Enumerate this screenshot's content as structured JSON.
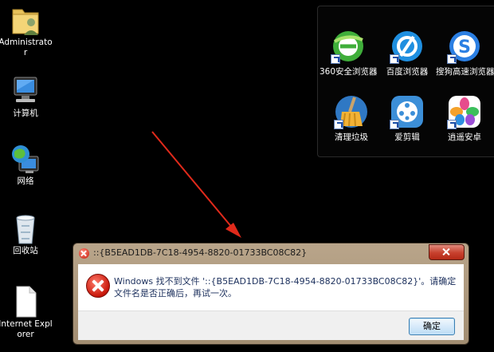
{
  "desktop": {
    "icons": [
      {
        "label": "Administrator",
        "icon": "user-folder-icon"
      },
      {
        "label": "计算机",
        "icon": "computer-icon"
      },
      {
        "label": "网络",
        "icon": "network-globe-icon"
      },
      {
        "label": "回收站",
        "icon": "recycle-bin-icon"
      },
      {
        "label": "Internet Explorer",
        "icon": "blank-file-icon"
      }
    ]
  },
  "fence": {
    "apps": [
      {
        "label": "360安全浏览器",
        "icon": "browser-360-icon",
        "color": "#4db34a"
      },
      {
        "label": "百度浏览器",
        "icon": "baidu-browser-icon",
        "color": "#1f8fe0"
      },
      {
        "label": "搜狗高速浏览器",
        "icon": "sogou-browser-icon",
        "color": "#2b7fe3"
      },
      {
        "label": "清理垃圾",
        "icon": "broom-clean-icon",
        "color": "#2f78c4"
      },
      {
        "label": "爱剪辑",
        "icon": "video-editor-icon",
        "color": "#3c8fd8"
      },
      {
        "label": "逍遥安卓",
        "icon": "android-emulator-icon",
        "color": "#e64b8c"
      }
    ]
  },
  "dialog": {
    "title": "::{B5EAD1DB-7C18-4954-8820-01733BC08C82}",
    "message": "Windows 找不到文件 '::{B5EAD1DB-7C18-4954-8820-01733BC08C82}'。请确定文件名是否正确后，再试一次。",
    "ok_label": "确定",
    "accent": "#c41b0c"
  }
}
